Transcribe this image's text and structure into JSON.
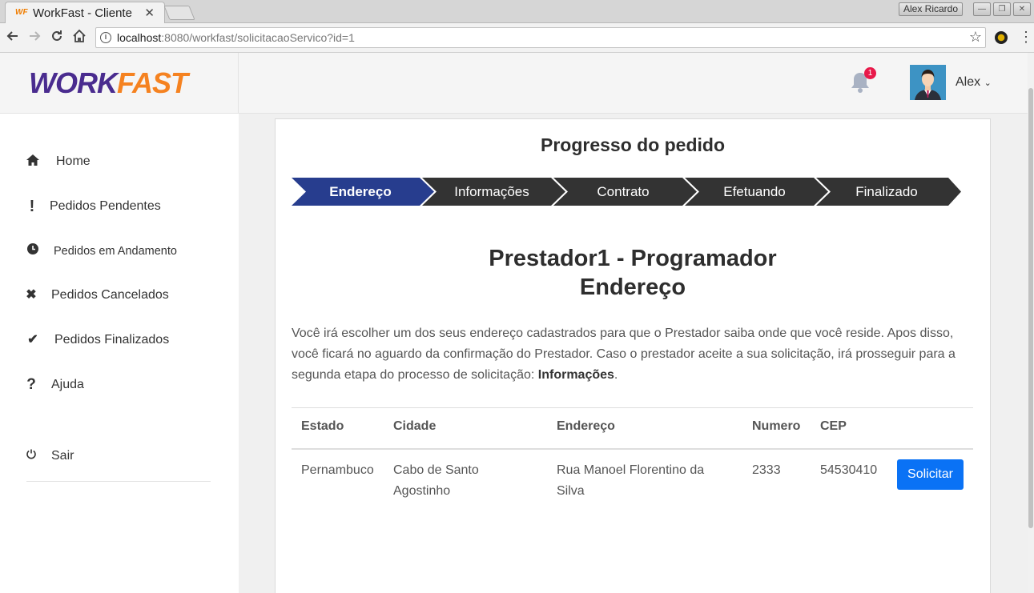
{
  "browser": {
    "tab_title": "WorkFast - Cliente",
    "tab_close": "✕",
    "favicon_text": [
      "W",
      "F"
    ],
    "url_host": "localhost",
    "url_rest": ":8080/workfast/solicitacaoServico?id=1",
    "window_user": "Alex Ricardo",
    "icons": [
      "back-icon",
      "forward-icon",
      "reload-icon",
      "home-icon",
      "info-icon",
      "star-icon",
      "extension-icon",
      "menu-icon"
    ]
  },
  "app": {
    "logo_part1": "WORK",
    "logo_part2": "FAST",
    "brand_colors": {
      "purple": "#4a2c8f",
      "orange": "#f58220"
    },
    "sidebar": {
      "items": [
        {
          "label": "Home",
          "icon": "home-icon"
        },
        {
          "label": "Pedidos Pendentes",
          "icon": "exclamation-icon"
        },
        {
          "label": "Pedidos em Andamento",
          "icon": "clock-icon"
        },
        {
          "label": "Pedidos Cancelados",
          "icon": "times-icon"
        },
        {
          "label": "Pedidos Finalizados",
          "icon": "check-icon"
        },
        {
          "label": "Ajuda",
          "icon": "question-icon"
        },
        {
          "label": "Sair",
          "icon": "power-icon"
        }
      ]
    },
    "topbar": {
      "notification_count": "1",
      "user_name": "Alex"
    }
  },
  "main": {
    "progress_title": "Progresso do pedido",
    "steps": [
      {
        "label": "Endereço",
        "active": true
      },
      {
        "label": "Informações",
        "active": false
      },
      {
        "label": "Contrato",
        "active": false
      },
      {
        "label": "Efetuando",
        "active": false
      },
      {
        "label": "Finalizado",
        "active": false
      }
    ],
    "step_colors": {
      "active": "#273d8e",
      "inactive": "#333333"
    },
    "heading_line1": "Prestador1 - Programador",
    "heading_line2": "Endereço",
    "description_text": "Você irá escolher um dos seus endereço cadastrados para que o Prestador saiba onde que você reside. Apos disso, você ficará no aguardo da confirmação do Prestador. Caso o prestador aceite a sua solicitação, irá prosseguir para a segunda etapa do processo de solicitação: ",
    "description_bold": "Informações",
    "description_end": ".",
    "table": {
      "headers": [
        "Estado",
        "Cidade",
        "Endereço",
        "Numero",
        "CEP"
      ],
      "rows": [
        {
          "estado": "Pernambuco",
          "cidade": "Cabo de Santo Agostinho",
          "endereco": "Rua Manoel Florentino da Silva",
          "numero": "2333",
          "cep": "54530410"
        }
      ],
      "action_label": "Solicitar",
      "action_color": "#0a72f5"
    }
  }
}
